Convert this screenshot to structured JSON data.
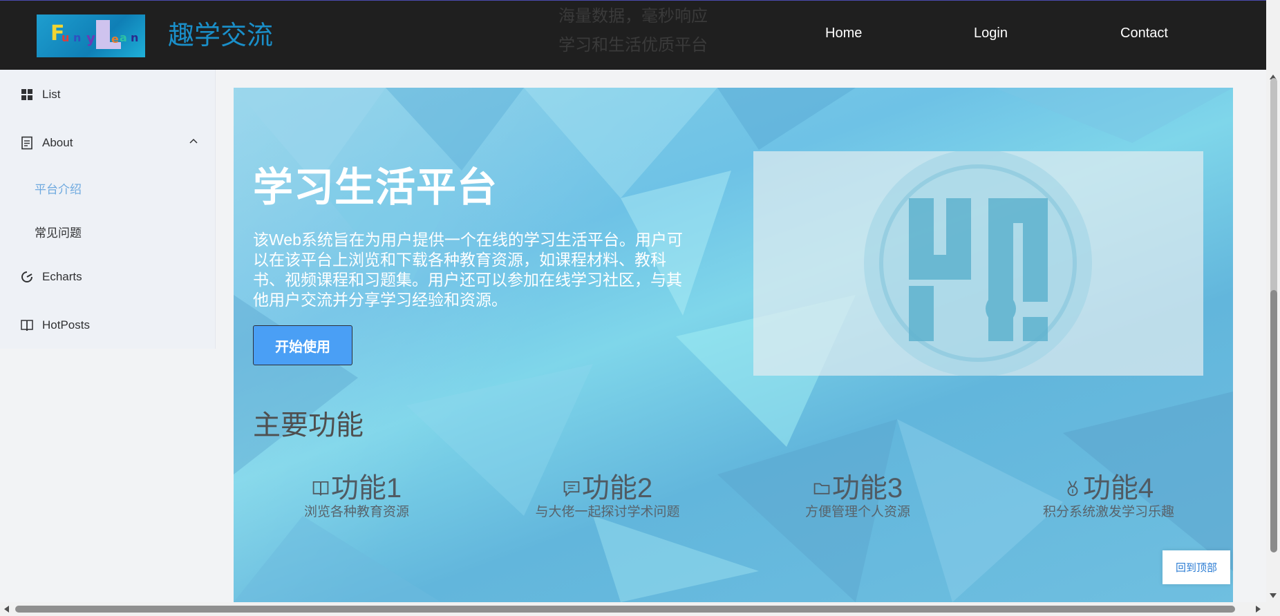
{
  "header": {
    "logo_text": "FunnyLearn",
    "site_title": "趣学交流",
    "slogan_lines": [
      "海量数据，毫秒响应",
      "学习和生活优质平台"
    ],
    "nav": [
      {
        "label": "Home"
      },
      {
        "label": "Login"
      },
      {
        "label": "Contact"
      }
    ]
  },
  "sidebar": {
    "items": [
      {
        "label": "List",
        "icon": "grid-icon"
      },
      {
        "label": "About",
        "icon": "document-icon",
        "expanded": true
      },
      {
        "label": "Echarts",
        "icon": "chart-icon"
      },
      {
        "label": "HotPosts",
        "icon": "book-icon"
      }
    ],
    "about_children": [
      {
        "label": "平台介绍",
        "active": true
      },
      {
        "label": "常见问题",
        "active": false
      }
    ]
  },
  "hero": {
    "title": "学习生活平台",
    "description": "该Web系统旨在为用户提供一个在线的学习生活平台。用户可以在该平台上浏览和下载各种教育资源，如课程材料、教科书、视频课程和习题集。用户还可以参加在线学习社区，与其他用户交流并分享学习经验和资源。",
    "start_button": "开始使用"
  },
  "features": {
    "title": "主要功能",
    "items": [
      {
        "title": "功能1",
        "desc": "浏览各种教育资源",
        "icon": "book-icon"
      },
      {
        "title": "功能2",
        "desc": "与大佬一起探讨学术问题",
        "icon": "chat-icon"
      },
      {
        "title": "功能3",
        "desc": "方便管理个人资源",
        "icon": "folder-icon"
      },
      {
        "title": "功能4",
        "desc": "积分系统激发学习乐趣",
        "icon": "medal-icon"
      }
    ]
  },
  "back_to_top": "回到顶部",
  "colors": {
    "header_bg": "#1f1f1f",
    "site_title": "#1a8fc9",
    "sidebar_bg": "#eef1f6",
    "active_sub": "#6ea9df",
    "button": "#4a9ff5",
    "hero_bg": "#6ec2e6"
  }
}
